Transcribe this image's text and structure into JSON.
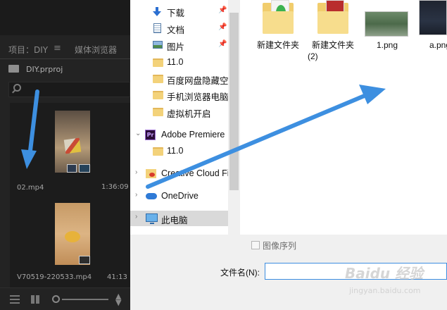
{
  "premiere": {
    "tabs": {
      "project": "项目：DIY",
      "menu_glyph": "≡",
      "media_browser": "媒体浏览器"
    },
    "project_file": "DIY.prproj",
    "clips": [
      {
        "name": "02.mp4",
        "duration": "1:36:09"
      },
      {
        "name": "V70519-220533.mp4",
        "duration": "41:13"
      }
    ]
  },
  "file_dialog": {
    "nav_items": [
      {
        "label": "下载",
        "icon": "download-icon",
        "pinned": true
      },
      {
        "label": "文档",
        "icon": "document-icon",
        "pinned": true
      },
      {
        "label": "图片",
        "icon": "picture-icon",
        "pinned": true
      },
      {
        "label": "11.0",
        "icon": "folder-icon"
      },
      {
        "label": "百度网盘隐藏空间",
        "icon": "folder-icon"
      },
      {
        "label": "手机浏览器电脑",
        "icon": "folder-icon"
      },
      {
        "label": "虚拟机开启",
        "icon": "folder-icon"
      },
      {
        "label": "Adobe Premiere",
        "icon": "premiere-icon",
        "expanded": true
      },
      {
        "label": "11.0",
        "icon": "folder-icon"
      },
      {
        "label": "Creative Cloud Files",
        "icon": "creative-cloud-folder-icon"
      },
      {
        "label": "OneDrive",
        "icon": "onedrive-icon"
      },
      {
        "label": "此电脑",
        "icon": "this-pc-icon",
        "selected": true
      }
    ],
    "files": [
      {
        "label": "新建文件夹",
        "type": "folder"
      },
      {
        "label": "新建文件夹",
        "label2": "(2)",
        "type": "folder"
      },
      {
        "label": "1.png",
        "type": "image"
      },
      {
        "label": "a.png",
        "type": "image"
      }
    ],
    "image_sequence_label": "图像序列",
    "filename_label": "文件名(N):",
    "filename_value": ""
  },
  "watermark": {
    "main": "Baidu 经验",
    "sub": "jingyan.baidu.com"
  },
  "colors": {
    "annotation_arrow": "#3d8fe0",
    "dialog_accent": "#3c8de0",
    "premiere_bg": "#232323"
  }
}
